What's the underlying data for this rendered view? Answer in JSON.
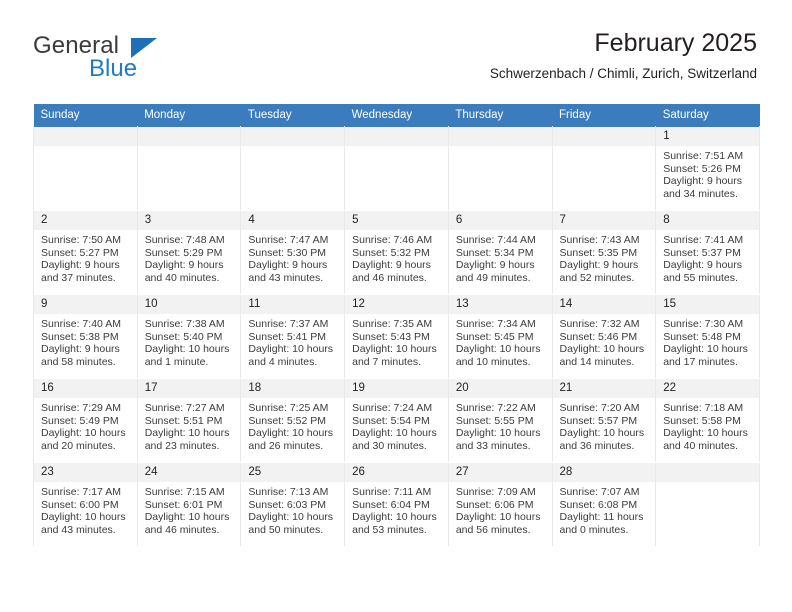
{
  "brand": {
    "word_one": "General",
    "word_two": "Blue",
    "triangle_icon": "triangle-icon",
    "accent_color": "#1d6fb8"
  },
  "header": {
    "title": "February 2025",
    "subtitle": "Schwerzenbach / Chimli, Zurich, Switzerland"
  },
  "theme": {
    "header_row_bg": "#3a7cbe",
    "daynum_bg": "#f2f2f2",
    "text_color": "#231f20"
  },
  "calendar": {
    "weekday_headers": [
      "Sunday",
      "Monday",
      "Tuesday",
      "Wednesday",
      "Thursday",
      "Friday",
      "Saturday"
    ],
    "labels": {
      "sunrise": "Sunrise:",
      "sunset": "Sunset:",
      "daylight": "Daylight:"
    },
    "weeks": [
      [
        {
          "day": "",
          "empty": true
        },
        {
          "day": "",
          "empty": true
        },
        {
          "day": "",
          "empty": true
        },
        {
          "day": "",
          "empty": true
        },
        {
          "day": "",
          "empty": true
        },
        {
          "day": "",
          "empty": true
        },
        {
          "day": "1",
          "sunrise": "Sunrise: 7:51 AM",
          "sunset": "Sunset: 5:26 PM",
          "daylight_line1": "Daylight: 9 hours",
          "daylight_line2": "and 34 minutes."
        }
      ],
      [
        {
          "day": "2",
          "sunrise": "Sunrise: 7:50 AM",
          "sunset": "Sunset: 5:27 PM",
          "daylight_line1": "Daylight: 9 hours",
          "daylight_line2": "and 37 minutes."
        },
        {
          "day": "3",
          "sunrise": "Sunrise: 7:48 AM",
          "sunset": "Sunset: 5:29 PM",
          "daylight_line1": "Daylight: 9 hours",
          "daylight_line2": "and 40 minutes."
        },
        {
          "day": "4",
          "sunrise": "Sunrise: 7:47 AM",
          "sunset": "Sunset: 5:30 PM",
          "daylight_line1": "Daylight: 9 hours",
          "daylight_line2": "and 43 minutes."
        },
        {
          "day": "5",
          "sunrise": "Sunrise: 7:46 AM",
          "sunset": "Sunset: 5:32 PM",
          "daylight_line1": "Daylight: 9 hours",
          "daylight_line2": "and 46 minutes."
        },
        {
          "day": "6",
          "sunrise": "Sunrise: 7:44 AM",
          "sunset": "Sunset: 5:34 PM",
          "daylight_line1": "Daylight: 9 hours",
          "daylight_line2": "and 49 minutes."
        },
        {
          "day": "7",
          "sunrise": "Sunrise: 7:43 AM",
          "sunset": "Sunset: 5:35 PM",
          "daylight_line1": "Daylight: 9 hours",
          "daylight_line2": "and 52 minutes."
        },
        {
          "day": "8",
          "sunrise": "Sunrise: 7:41 AM",
          "sunset": "Sunset: 5:37 PM",
          "daylight_line1": "Daylight: 9 hours",
          "daylight_line2": "and 55 minutes."
        }
      ],
      [
        {
          "day": "9",
          "sunrise": "Sunrise: 7:40 AM",
          "sunset": "Sunset: 5:38 PM",
          "daylight_line1": "Daylight: 9 hours",
          "daylight_line2": "and 58 minutes."
        },
        {
          "day": "10",
          "sunrise": "Sunrise: 7:38 AM",
          "sunset": "Sunset: 5:40 PM",
          "daylight_line1": "Daylight: 10 hours",
          "daylight_line2": "and 1 minute."
        },
        {
          "day": "11",
          "sunrise": "Sunrise: 7:37 AM",
          "sunset": "Sunset: 5:41 PM",
          "daylight_line1": "Daylight: 10 hours",
          "daylight_line2": "and 4 minutes."
        },
        {
          "day": "12",
          "sunrise": "Sunrise: 7:35 AM",
          "sunset": "Sunset: 5:43 PM",
          "daylight_line1": "Daylight: 10 hours",
          "daylight_line2": "and 7 minutes."
        },
        {
          "day": "13",
          "sunrise": "Sunrise: 7:34 AM",
          "sunset": "Sunset: 5:45 PM",
          "daylight_line1": "Daylight: 10 hours",
          "daylight_line2": "and 10 minutes."
        },
        {
          "day": "14",
          "sunrise": "Sunrise: 7:32 AM",
          "sunset": "Sunset: 5:46 PM",
          "daylight_line1": "Daylight: 10 hours",
          "daylight_line2": "and 14 minutes."
        },
        {
          "day": "15",
          "sunrise": "Sunrise: 7:30 AM",
          "sunset": "Sunset: 5:48 PM",
          "daylight_line1": "Daylight: 10 hours",
          "daylight_line2": "and 17 minutes."
        }
      ],
      [
        {
          "day": "16",
          "sunrise": "Sunrise: 7:29 AM",
          "sunset": "Sunset: 5:49 PM",
          "daylight_line1": "Daylight: 10 hours",
          "daylight_line2": "and 20 minutes."
        },
        {
          "day": "17",
          "sunrise": "Sunrise: 7:27 AM",
          "sunset": "Sunset: 5:51 PM",
          "daylight_line1": "Daylight: 10 hours",
          "daylight_line2": "and 23 minutes."
        },
        {
          "day": "18",
          "sunrise": "Sunrise: 7:25 AM",
          "sunset": "Sunset: 5:52 PM",
          "daylight_line1": "Daylight: 10 hours",
          "daylight_line2": "and 26 minutes."
        },
        {
          "day": "19",
          "sunrise": "Sunrise: 7:24 AM",
          "sunset": "Sunset: 5:54 PM",
          "daylight_line1": "Daylight: 10 hours",
          "daylight_line2": "and 30 minutes."
        },
        {
          "day": "20",
          "sunrise": "Sunrise: 7:22 AM",
          "sunset": "Sunset: 5:55 PM",
          "daylight_line1": "Daylight: 10 hours",
          "daylight_line2": "and 33 minutes."
        },
        {
          "day": "21",
          "sunrise": "Sunrise: 7:20 AM",
          "sunset": "Sunset: 5:57 PM",
          "daylight_line1": "Daylight: 10 hours",
          "daylight_line2": "and 36 minutes."
        },
        {
          "day": "22",
          "sunrise": "Sunrise: 7:18 AM",
          "sunset": "Sunset: 5:58 PM",
          "daylight_line1": "Daylight: 10 hours",
          "daylight_line2": "and 40 minutes."
        }
      ],
      [
        {
          "day": "23",
          "sunrise": "Sunrise: 7:17 AM",
          "sunset": "Sunset: 6:00 PM",
          "daylight_line1": "Daylight: 10 hours",
          "daylight_line2": "and 43 minutes."
        },
        {
          "day": "24",
          "sunrise": "Sunrise: 7:15 AM",
          "sunset": "Sunset: 6:01 PM",
          "daylight_line1": "Daylight: 10 hours",
          "daylight_line2": "and 46 minutes."
        },
        {
          "day": "25",
          "sunrise": "Sunrise: 7:13 AM",
          "sunset": "Sunset: 6:03 PM",
          "daylight_line1": "Daylight: 10 hours",
          "daylight_line2": "and 50 minutes."
        },
        {
          "day": "26",
          "sunrise": "Sunrise: 7:11 AM",
          "sunset": "Sunset: 6:04 PM",
          "daylight_line1": "Daylight: 10 hours",
          "daylight_line2": "and 53 minutes."
        },
        {
          "day": "27",
          "sunrise": "Sunrise: 7:09 AM",
          "sunset": "Sunset: 6:06 PM",
          "daylight_line1": "Daylight: 10 hours",
          "daylight_line2": "and 56 minutes."
        },
        {
          "day": "28",
          "sunrise": "Sunrise: 7:07 AM",
          "sunset": "Sunset: 6:08 PM",
          "daylight_line1": "Daylight: 11 hours",
          "daylight_line2": "and 0 minutes."
        },
        {
          "day": "",
          "empty": true
        }
      ]
    ]
  }
}
